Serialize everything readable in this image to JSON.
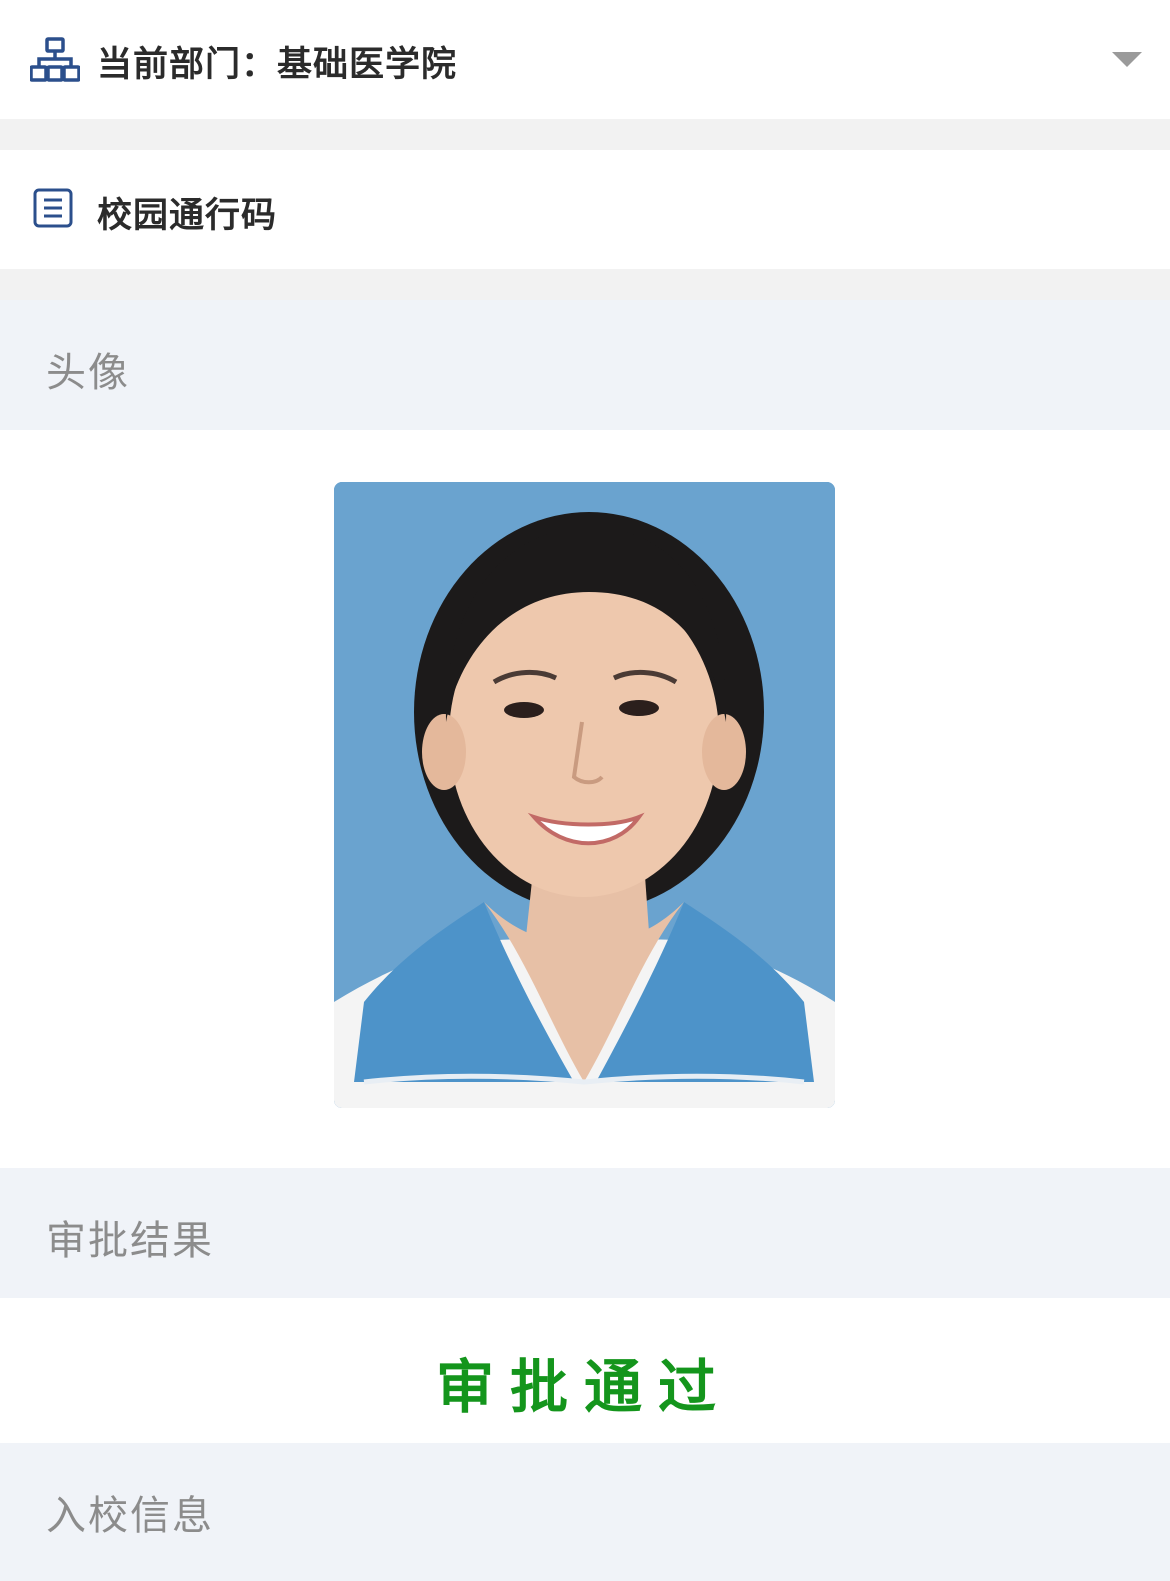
{
  "department": {
    "label": "当前部门：基础医学院",
    "icon": "org-chart-icon",
    "dropdown_icon": "caret-down-icon"
  },
  "pass": {
    "title": "校园通行码",
    "icon": "document-list-icon"
  },
  "sections": {
    "avatar": "头像",
    "approval": "审批结果",
    "entry": "入校信息"
  },
  "approval_result": "审批通过",
  "colors": {
    "approved": "#14951c",
    "icon_blue": "#2b4f8c",
    "section_bg": "#f0f3f8",
    "photo_bg": "#6aa3cf"
  }
}
